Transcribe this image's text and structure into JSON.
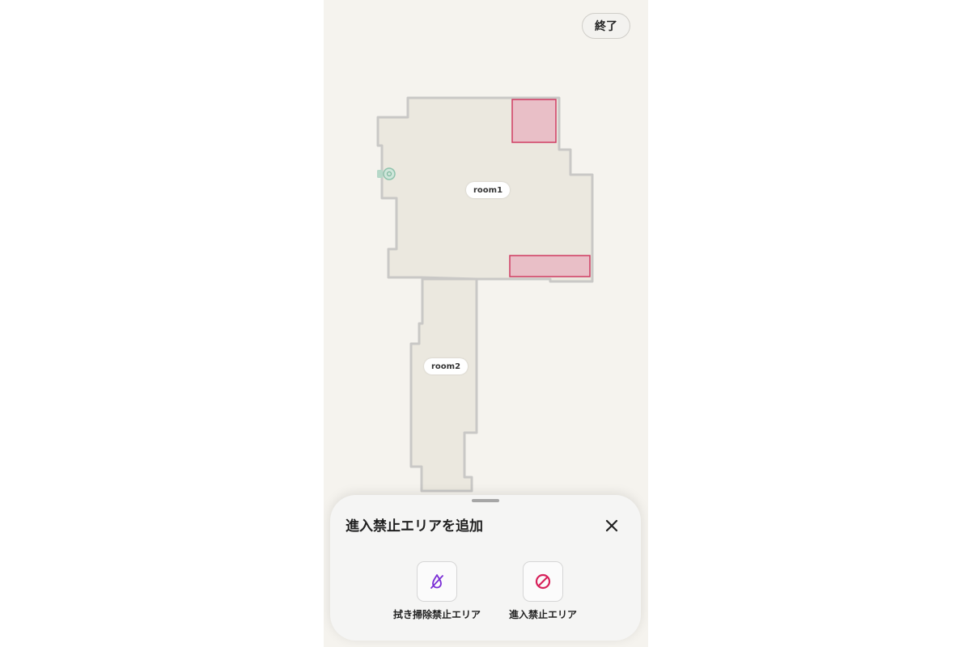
{
  "header": {
    "done_label": "終了"
  },
  "map": {
    "rooms": [
      {
        "id": "room1",
        "label": "room1"
      },
      {
        "id": "room2",
        "label": "room2"
      }
    ],
    "no_go_zone_count": 2,
    "colors": {
      "floor": "#ebe8df",
      "wall": "#c9c8c6",
      "no_go_fill": "#e9bfc7",
      "no_go_border": "#d03c62",
      "dock": "#9ec9b6"
    }
  },
  "sheet": {
    "title": "進入禁止エリアを追加",
    "close_icon": "close-icon",
    "options": [
      {
        "label": "拭き掃除禁止エリア",
        "icon": "no-mop-icon",
        "color": "#7b2fd6"
      },
      {
        "label": "進入禁止エリア",
        "icon": "no-entry-icon",
        "color": "#d7225b"
      }
    ]
  }
}
